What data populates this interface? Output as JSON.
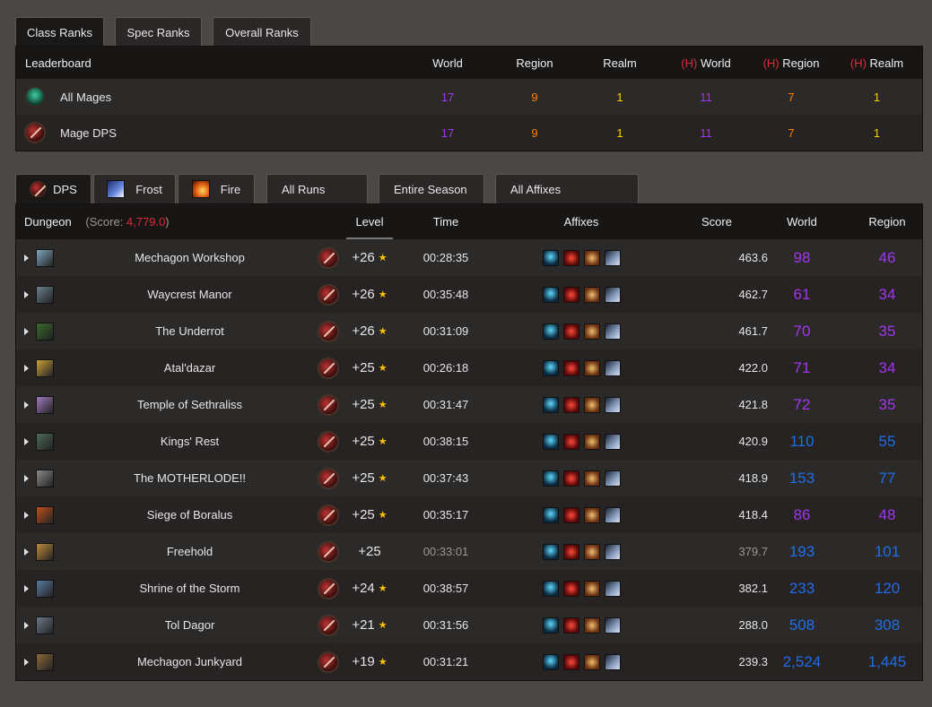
{
  "top_tabs": [
    "Class Ranks",
    "Spec Ranks",
    "Overall Ranks"
  ],
  "leaderboard": {
    "headers": {
      "name": "Leaderboard",
      "world": "World",
      "region": "Region",
      "realm": "Realm",
      "h_prefix": "(H)",
      "h_world": "World",
      "h_region": "Region",
      "h_realm": "Realm"
    },
    "rows": [
      {
        "name": "All Mages",
        "world": "17",
        "region": "9",
        "realm": "1",
        "h_world": "11",
        "h_region": "7",
        "h_realm": "1",
        "icon": "mage-class-icon"
      },
      {
        "name": "Mage DPS",
        "world": "17",
        "region": "9",
        "realm": "1",
        "h_world": "11",
        "h_region": "7",
        "h_realm": "1",
        "icon": "dps-role-icon"
      }
    ]
  },
  "filter_tabs": [
    {
      "label": "DPS",
      "icon": "dps-role-icon"
    },
    {
      "label": "Frost",
      "icon": "frost-spec-icon"
    },
    {
      "label": "Fire",
      "icon": "fire-spec-icon"
    },
    {
      "label": "All Runs"
    },
    {
      "label": "Entire Season"
    },
    {
      "label": "All Affixes"
    }
  ],
  "runs": {
    "headers": {
      "dungeon": "Dungeon",
      "score_prefix": "(Score: ",
      "score_value": "4,779.0",
      "score_suffix": ")",
      "level": "Level",
      "time": "Time",
      "affixes": "Affixes",
      "score": "Score",
      "world": "World",
      "region": "Region"
    },
    "rows": [
      {
        "dungeon": "Mechagon Workshop",
        "level": "+26",
        "star": true,
        "time": "00:28:35",
        "score": "463.6",
        "world": "98",
        "region": "46",
        "world_color": "#a335ee",
        "timed": true,
        "icon_color": "#7fa7c0"
      },
      {
        "dungeon": "Waycrest Manor",
        "level": "+26",
        "star": true,
        "time": "00:35:48",
        "score": "462.7",
        "world": "61",
        "region": "34",
        "world_color": "#a335ee",
        "timed": true,
        "icon_color": "#6b8090"
      },
      {
        "dungeon": "The Underrot",
        "level": "+26",
        "star": true,
        "time": "00:31:09",
        "score": "461.7",
        "world": "70",
        "region": "35",
        "world_color": "#a335ee",
        "timed": true,
        "icon_color": "#3a6a2a"
      },
      {
        "dungeon": "Atal'dazar",
        "level": "+25",
        "star": true,
        "time": "00:26:18",
        "score": "422.0",
        "world": "71",
        "region": "34",
        "world_color": "#a335ee",
        "timed": true,
        "icon_color": "#c9a23a"
      },
      {
        "dungeon": "Temple of Sethraliss",
        "level": "+25",
        "star": true,
        "time": "00:31:47",
        "score": "421.8",
        "world": "72",
        "region": "35",
        "world_color": "#a335ee",
        "timed": true,
        "icon_color": "#a07ac0"
      },
      {
        "dungeon": "Kings' Rest",
        "level": "+25",
        "star": true,
        "time": "00:38:15",
        "score": "420.9",
        "world": "110",
        "region": "55",
        "world_color": "#1f6ee8",
        "timed": true,
        "icon_color": "#4f6a5a"
      },
      {
        "dungeon": "The MOTHERLODE!!",
        "level": "+25",
        "star": true,
        "time": "00:37:43",
        "score": "418.9",
        "world": "153",
        "region": "77",
        "world_color": "#1f6ee8",
        "timed": true,
        "icon_color": "#8a8a8a"
      },
      {
        "dungeon": "Siege of Boralus",
        "level": "+25",
        "star": true,
        "time": "00:35:17",
        "score": "418.4",
        "world": "86",
        "region": "48",
        "world_color": "#a335ee",
        "timed": true,
        "icon_color": "#c0501a"
      },
      {
        "dungeon": "Freehold",
        "level": "+25",
        "star": false,
        "time": "00:33:01",
        "score": "379.7",
        "world": "193",
        "region": "101",
        "world_color": "#1f6ee8",
        "timed": false,
        "icon_color": "#c08a3a"
      },
      {
        "dungeon": "Shrine of the Storm",
        "level": "+24",
        "star": true,
        "time": "00:38:57",
        "score": "382.1",
        "world": "233",
        "region": "120",
        "world_color": "#1f6ee8",
        "timed": true,
        "icon_color": "#5a7aa0"
      },
      {
        "dungeon": "Tol Dagor",
        "level": "+21",
        "star": true,
        "time": "00:31:56",
        "score": "288.0",
        "world": "508",
        "region": "308",
        "world_color": "#1f6ee8",
        "timed": true,
        "icon_color": "#6a7a8a"
      },
      {
        "dungeon": "Mechagon Junkyard",
        "level": "+19",
        "star": true,
        "time": "00:31:21",
        "score": "239.3",
        "world": "2,524",
        "region": "1,445",
        "world_color": "#1f6ee8",
        "timed": true,
        "icon_color": "#8a6a3a"
      }
    ],
    "affix_icons": [
      "fortified-affix-icon",
      "bolstering-affix-icon",
      "necrotic-affix-icon",
      "awakened-affix-icon"
    ]
  }
}
